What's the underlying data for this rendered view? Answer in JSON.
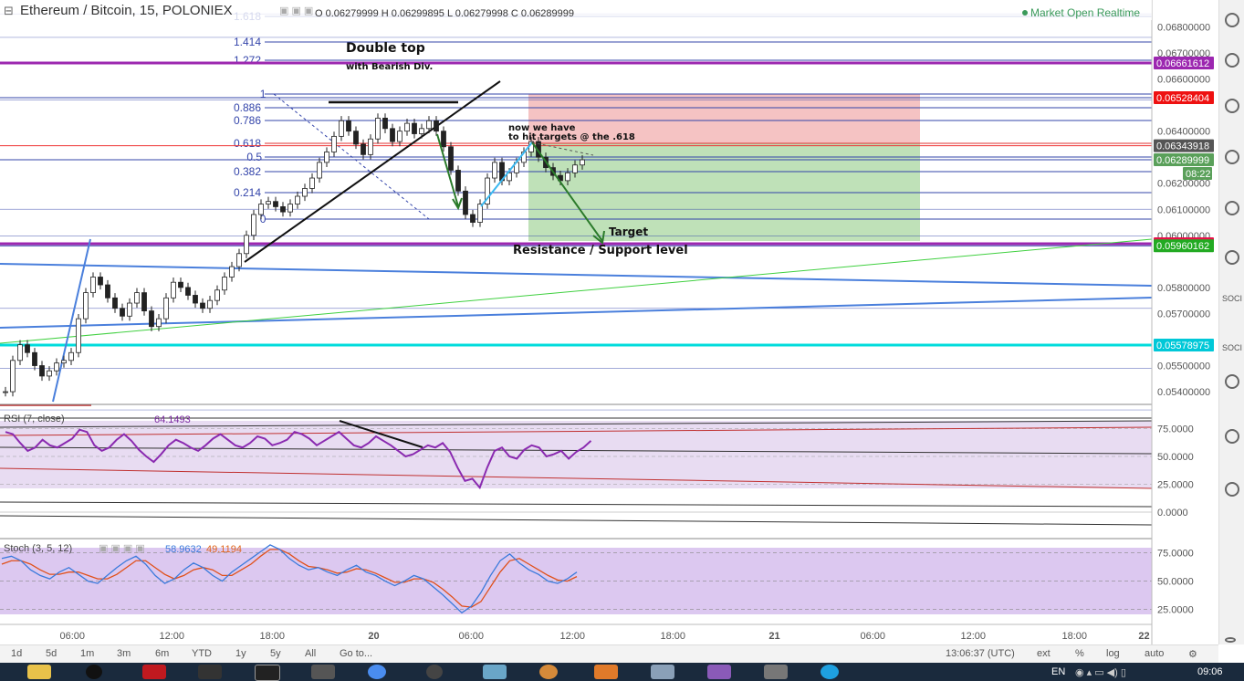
{
  "header": {
    "title": "Ethereum / Bitcoin, 15, POLONIEX",
    "ohlc": "O 0.06279999  H 0.06299895  L 0.06279998  C 0.06289999",
    "status": "Market Open  Realtime"
  },
  "price_axis": {
    "ticks": [
      "0.06800000",
      "0.06700000",
      "0.06600000",
      "0.06400000",
      "0.06200000",
      "0.06100000",
      "0.06000000",
      "0.05800000",
      "0.05700000",
      "0.05500000",
      "0.05400000"
    ],
    "badges": [
      {
        "label": "0.06661612",
        "color": "#9c27b0"
      },
      {
        "label": "0.06528404",
        "color": "#ee1111"
      },
      {
        "label": "0.06343918",
        "color": "#555555"
      },
      {
        "label": "0.06289999",
        "color": "#5aa05a"
      },
      {
        "label": "08:22",
        "color": "#5aa05a"
      },
      {
        "label": "0.05967703",
        "color": "#e8104a"
      },
      {
        "label": "0.05960162",
        "color": "#22aa22"
      },
      {
        "label": "0.05578975",
        "color": "#00c8d8"
      }
    ]
  },
  "fib_labels": [
    "1.618",
    "1.414",
    "1.272",
    "1",
    "0.886",
    "0.786",
    "0.618",
    "0.5",
    "0.382",
    "0.214",
    "0"
  ],
  "annotations": {
    "double_top": "Double top",
    "bearish_div": "with Bearish Div.",
    "now_we_have": "now we have",
    "hit_targets": "to hit targets @ the .618",
    "target": "Target",
    "resistance": "Resistance / Support level"
  },
  "rsi": {
    "label": "RSI (7, close)",
    "value": "64.1493",
    "ticks": [
      "75.0000",
      "50.0000",
      "25.0000",
      "0.0000"
    ]
  },
  "stoch": {
    "label": "Stoch (3, 5, 12)",
    "k_value": "58.9632",
    "d_value": "49.1194",
    "ticks": [
      "75.0000",
      "50.0000",
      "25.0000"
    ]
  },
  "time_axis": [
    "06:00",
    "12:00",
    "18:00",
    "20",
    "06:00",
    "12:00",
    "18:00",
    "21",
    "06:00",
    "12:00",
    "18:00",
    "22"
  ],
  "toolbar": {
    "periods": [
      "1d",
      "5d",
      "1m",
      "3m",
      "6m",
      "YTD",
      "1y",
      "5y",
      "All"
    ],
    "goto": "Go to...",
    "clock": "13:06:37 (UTC)",
    "right_buttons": [
      "ext",
      "%",
      "log",
      "auto"
    ]
  },
  "taskbar": {
    "lang": "EN",
    "time": "09:06"
  },
  "sidebar": {
    "soci1": "SOCI",
    "soci2": "SOCI"
  },
  "chart_data": {
    "type": "candlestick",
    "title": "Ethereum / Bitcoin, 15, POLONIEX",
    "ylim": [
      0.0535,
      0.0685
    ],
    "ohlc_last": {
      "open": 0.06279999,
      "high": 0.06299895,
      "low": 0.06279998,
      "close": 0.06289999
    },
    "horizontal_levels": [
      0.06661612,
      0.06528404,
      0.06343918,
      0.06289999,
      0.05967703,
      0.05960162,
      0.05578975
    ],
    "closes": [
      0.054,
      0.0552,
      0.0558,
      0.0555,
      0.055,
      0.0546,
      0.0548,
      0.0551,
      0.0552,
      0.0555,
      0.0568,
      0.0578,
      0.0584,
      0.0581,
      0.0576,
      0.0572,
      0.0569,
      0.0574,
      0.0578,
      0.0571,
      0.0565,
      0.0568,
      0.0576,
      0.0582,
      0.058,
      0.0577,
      0.0574,
      0.0572,
      0.0575,
      0.0579,
      0.0584,
      0.0588,
      0.0593,
      0.06,
      0.0608,
      0.0612,
      0.0613,
      0.0611,
      0.0609,
      0.0612,
      0.0615,
      0.0618,
      0.0622,
      0.0628,
      0.0632,
      0.0638,
      0.0644,
      0.064,
      0.0635,
      0.0631,
      0.0637,
      0.0645,
      0.0641,
      0.0636,
      0.064,
      0.0643,
      0.0639,
      0.0641,
      0.0644,
      0.064,
      0.0634,
      0.0625,
      0.0617,
      0.0608,
      0.0605,
      0.0612,
      0.0622,
      0.0628,
      0.0621,
      0.0624,
      0.0628,
      0.0632,
      0.0636,
      0.063,
      0.0626,
      0.0623,
      0.0621,
      0.0624,
      0.0627,
      0.0629
    ],
    "rsi_values": [
      72,
      70,
      62,
      55,
      58,
      65,
      60,
      58,
      62,
      66,
      74,
      72,
      60,
      55,
      58,
      65,
      70,
      64,
      56,
      50,
      45,
      52,
      60,
      65,
      62,
      58,
      55,
      60,
      66,
      70,
      65,
      60,
      58,
      62,
      68,
      66,
      60,
      62,
      65,
      72,
      70,
      66,
      60,
      64,
      68,
      72,
      66,
      60,
      58,
      62,
      68,
      64,
      60,
      55,
      50,
      52,
      56,
      60,
      58,
      62,
      54,
      40,
      28,
      30,
      22,
      40,
      55,
      58,
      50,
      48,
      56,
      60,
      58,
      50,
      52,
      55,
      48,
      54,
      58,
      64
    ],
    "stoch_k": [
      70,
      72,
      68,
      60,
      55,
      52,
      58,
      62,
      56,
      50,
      48,
      55,
      62,
      68,
      72,
      65,
      55,
      48,
      52,
      60,
      66,
      62,
      55,
      50,
      58,
      64,
      70,
      76,
      82,
      78,
      70,
      64,
      60,
      62,
      58,
      55,
      60,
      64,
      58,
      55,
      50,
      46,
      50,
      55,
      52,
      45,
      38,
      30,
      22,
      28,
      40,
      55,
      68,
      74,
      66,
      60,
      56,
      50,
      48,
      52,
      58
    ],
    "stoch_d": [
      65,
      68,
      68,
      65,
      60,
      56,
      56,
      58,
      58,
      55,
      52,
      52,
      56,
      62,
      68,
      68,
      62,
      56,
      52,
      55,
      60,
      62,
      60,
      55,
      55,
      60,
      65,
      72,
      78,
      78,
      74,
      68,
      63,
      62,
      60,
      57,
      58,
      61,
      60,
      57,
      53,
      49,
      49,
      52,
      52,
      49,
      43,
      36,
      28,
      27,
      32,
      45,
      58,
      68,
      70,
      65,
      60,
      55,
      51,
      50,
      54
    ]
  }
}
